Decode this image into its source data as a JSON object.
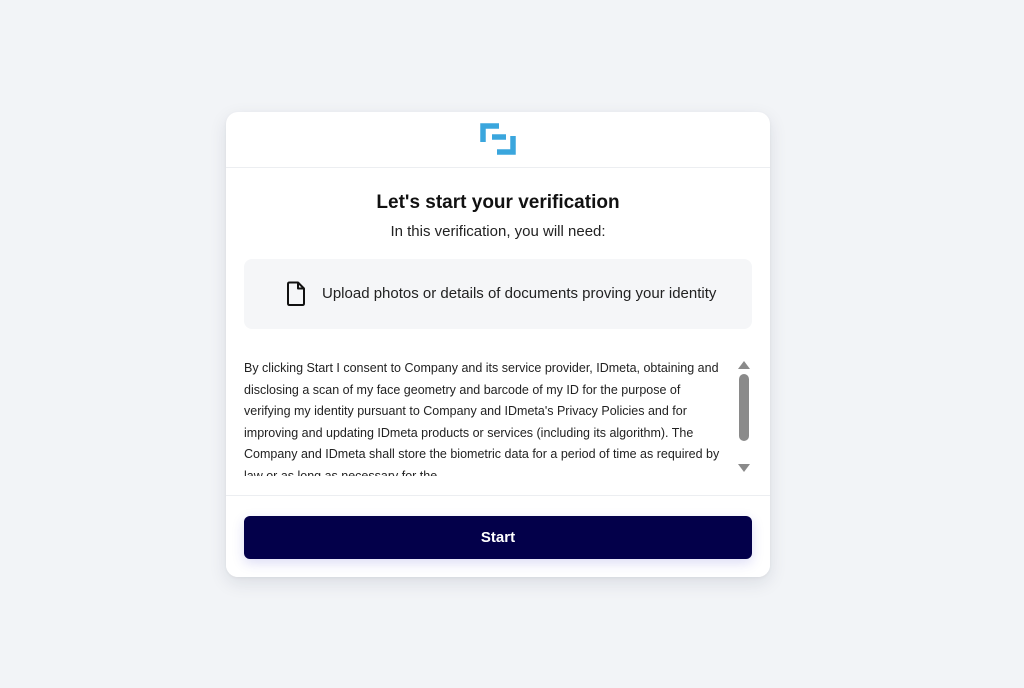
{
  "header": {
    "logo": "idmeta-logo-icon",
    "logo_color": "#3aa6dd"
  },
  "main": {
    "title": "Let's start your verification",
    "subtitle": "In this verification, you will need:",
    "requirements": [
      {
        "icon": "document-icon",
        "text": "Upload photos or details of documents proving your identity"
      }
    ],
    "consent_text": "By clicking Start I consent to Company and its service provider, IDmeta, obtaining and disclosing a scan of my face geometry and barcode of my ID for the purpose of verifying my identity pursuant to Company and IDmeta's Privacy Policies and for improving and updating IDmeta products or services (including its algorithm). The Company and IDmeta shall store the biometric data for a period of time as required by law or as long as necessary for the"
  },
  "footer": {
    "start_label": "Start",
    "button_color": "#03004a"
  }
}
